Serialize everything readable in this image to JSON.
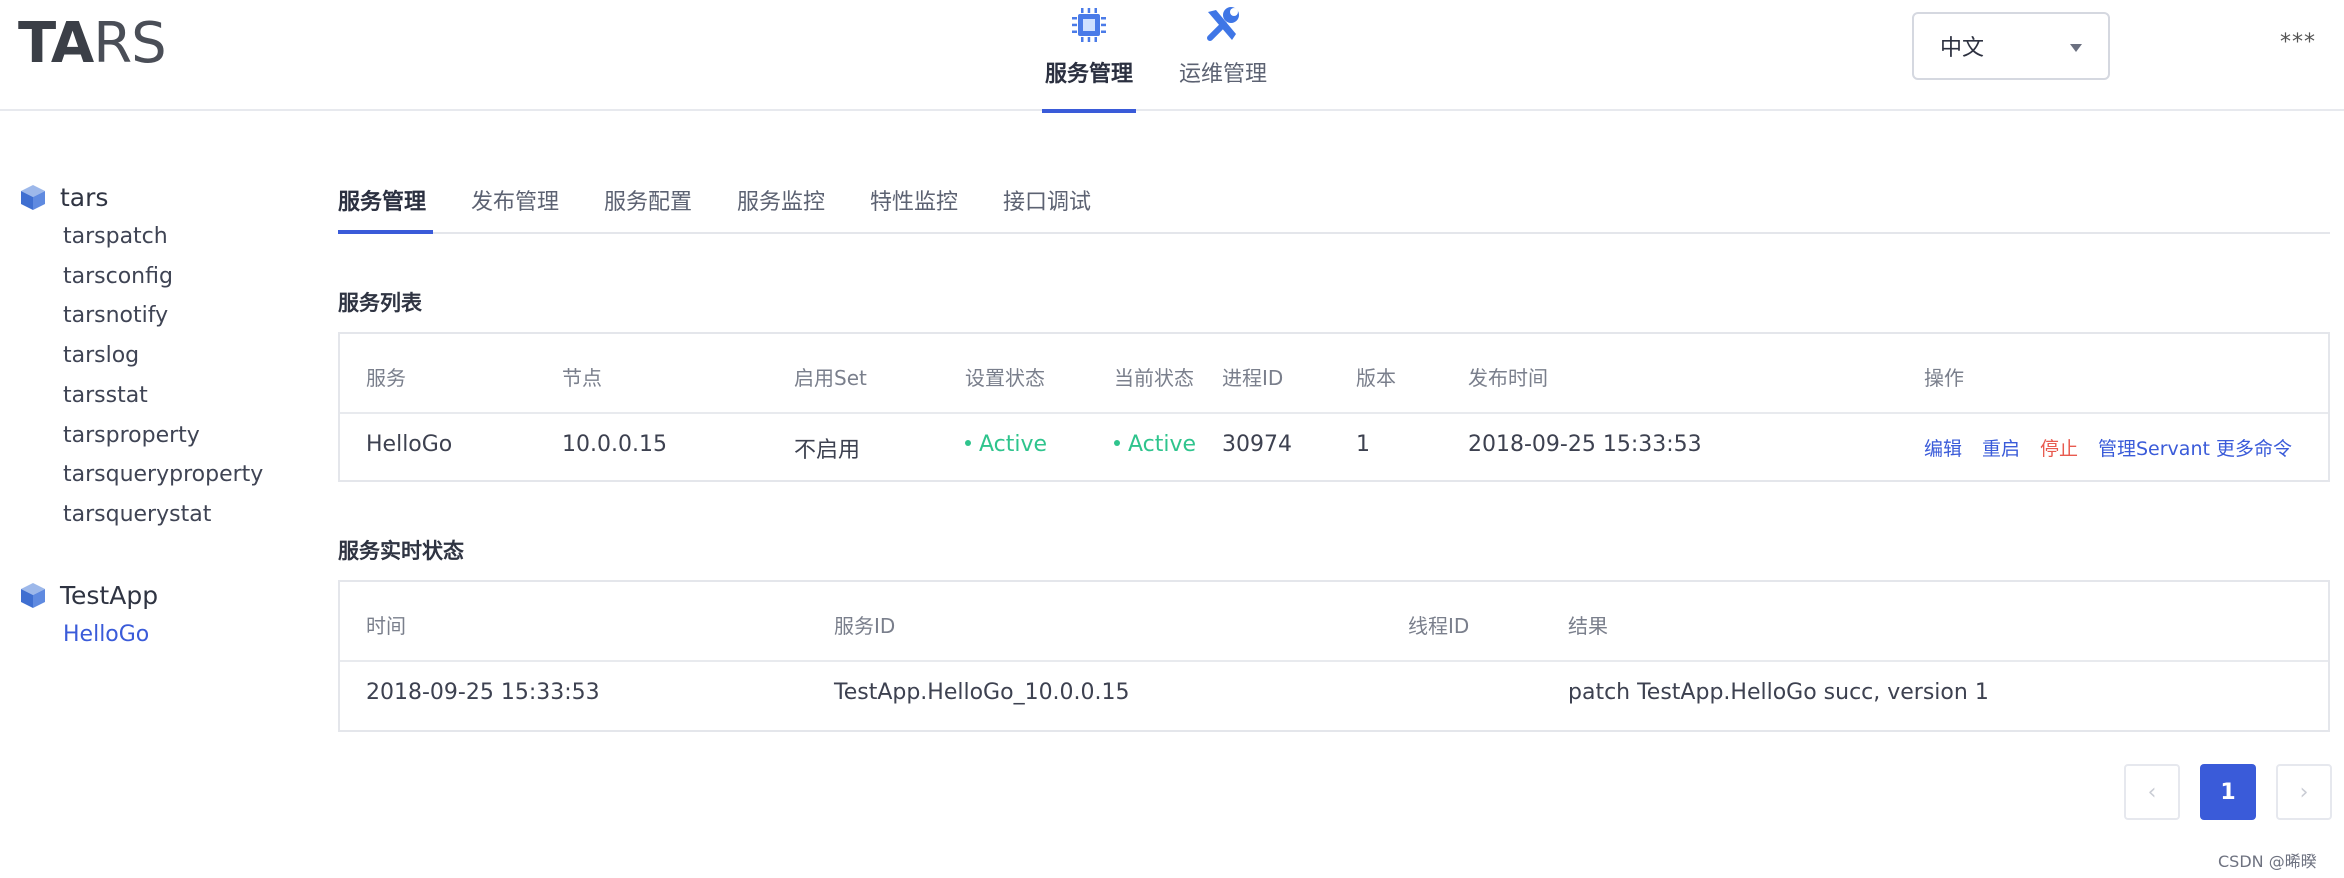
{
  "header": {
    "logo_left": "TA",
    "logo_right": "RS",
    "nav": [
      {
        "label": "服务管理",
        "icon": "cpu-chip-icon",
        "active": true
      },
      {
        "label": "运维管理",
        "icon": "wrench-screwdriver-icon",
        "active": false
      }
    ],
    "language": {
      "selected": "中文"
    },
    "more_label": "***"
  },
  "colors": {
    "accent": "#3a5bd9",
    "active_status": "#2fc48d",
    "danger": "#e85a4f"
  },
  "sidebar": {
    "apps": [
      {
        "name": "tars",
        "icon": "cube-icon",
        "servers": [
          "tarspatch",
          "tarsconfig",
          "tarsnotify",
          "tarslog",
          "tarsstat",
          "tarsproperty",
          "tarsqueryproperty",
          "tarsquerystat"
        ]
      },
      {
        "name": "TestApp",
        "icon": "cube-icon",
        "servers": [
          "HelloGo"
        ],
        "selected_server": "HelloGo"
      }
    ]
  },
  "tabs": [
    "服务管理",
    "发布管理",
    "服务配置",
    "服务监控",
    "特性监控",
    "接口调试"
  ],
  "service_list": {
    "title": "服务列表",
    "columns": [
      "服务",
      "节点",
      "启用Set",
      "设置状态",
      "当前状态",
      "进程ID",
      "版本",
      "发布时间",
      "操作"
    ],
    "rows": [
      {
        "service": "HelloGo",
        "node": "10.0.0.15",
        "set": "不启用",
        "setting_state": "Active",
        "present_state": "Active",
        "pid": "30974",
        "version": "1",
        "publish_time": "2018-09-25 15:33:53",
        "actions": [
          "编辑",
          "重启",
          "停止",
          "管理Servant",
          "更多命令"
        ]
      }
    ]
  },
  "realtime_status": {
    "title": "服务实时状态",
    "columns": [
      "时间",
      "服务ID",
      "线程ID",
      "结果"
    ],
    "rows": [
      {
        "time": "2018-09-25 15:33:53",
        "service_id": "TestApp.HelloGo_10.0.0.15",
        "thread_id": "",
        "result": "patch TestApp.HelloGo succ, version 1"
      }
    ]
  },
  "pagination": {
    "prev": "‹",
    "current": "1",
    "next": "›"
  },
  "watermark": "CSDN @晞暌"
}
